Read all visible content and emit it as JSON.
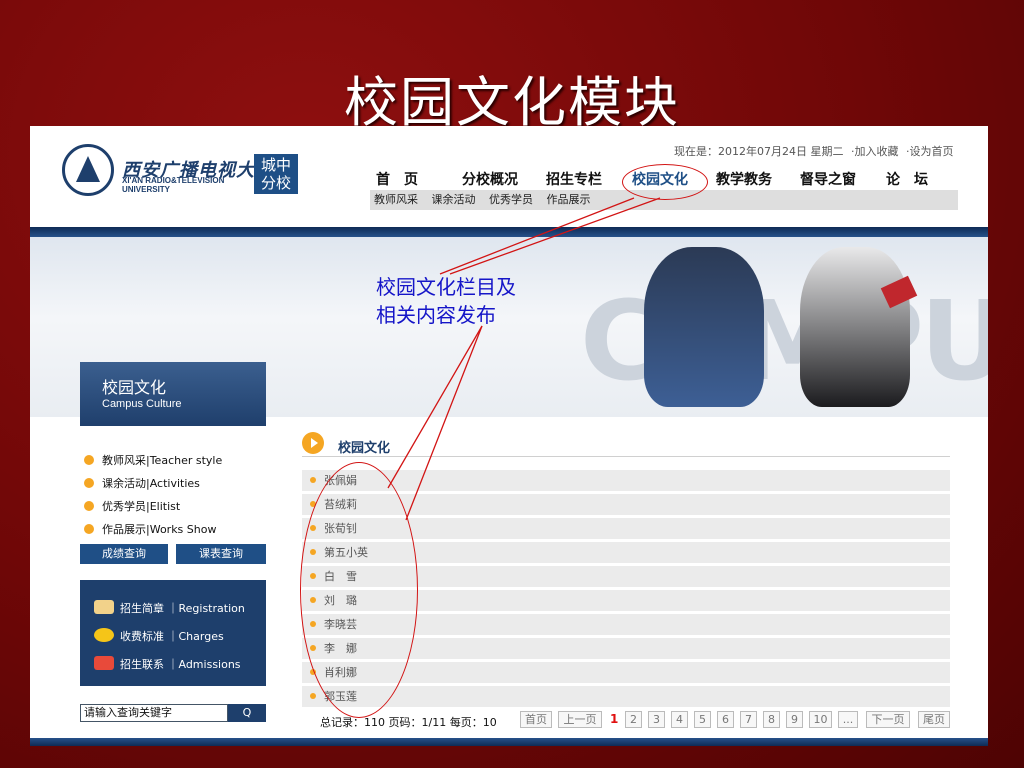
{
  "slide": {
    "title": "校园文化模块"
  },
  "header": {
    "logo_cn": "西安广播电视大学",
    "logo_en_line1": "XI'AN RADIO&TELEVISION",
    "logo_en_line2": "UNIVERSITY",
    "badge_line1": "城中",
    "badge_line2": "分校",
    "date_text": "现在是：2012年07月24日 星期二",
    "add_favorite": "·加入收藏",
    "set_homepage": "·设为首页"
  },
  "nav": {
    "items": [
      "首　页",
      "分校概况",
      "招生专栏",
      "校园文化",
      "教学教务",
      "督导之窗",
      "论　坛"
    ],
    "active": "校园文化",
    "subnav": [
      "教师风采",
      "课余活动",
      "优秀学员",
      "作品展示"
    ]
  },
  "annotation": {
    "note_line1": "校园文化栏目及",
    "note_line2": "相关内容发布",
    "color": "#d21414"
  },
  "sidebar": {
    "title_cn": "校园文化",
    "title_en": "Campus Culture",
    "menu": [
      {
        "label": "教师风采|Teacher style"
      },
      {
        "label": "课余活动|Activities"
      },
      {
        "label": "优秀学员|Elitist"
      },
      {
        "label": "作品展示|Works Show"
      }
    ],
    "btn_score": "成绩查询",
    "btn_schedule": "课表查询",
    "reg": [
      {
        "label": "招生简章 ｜Registration",
        "icon": "book-icon"
      },
      {
        "label": "收费标准 ｜Charges",
        "icon": "coin-icon"
      },
      {
        "label": "招生联系 ｜Admissions",
        "icon": "letter-icon"
      }
    ],
    "search_placeholder": "请输入查询关键字",
    "search_btn": "Q"
  },
  "content": {
    "section_title": "校园文化",
    "names": [
      "张佩娟",
      "苔绒莉",
      "张荀钊",
      "第五小英",
      "白　雪",
      "刘　璐",
      "李晓芸",
      "李　娜",
      "肖利娜",
      "郭玉莲"
    ]
  },
  "pager": {
    "info": "总记录：110 页码：1/11 每页：10",
    "first": "首页",
    "prev": "上一页",
    "current": "1",
    "pages": [
      "2",
      "3",
      "4",
      "5",
      "6",
      "7",
      "8",
      "9",
      "10"
    ],
    "more": "...",
    "next": "下一页",
    "last": "尾页"
  },
  "colors": {
    "accent": "#1e3f6c",
    "bullet": "#f5a623",
    "slide_bg": "#6f0707"
  }
}
